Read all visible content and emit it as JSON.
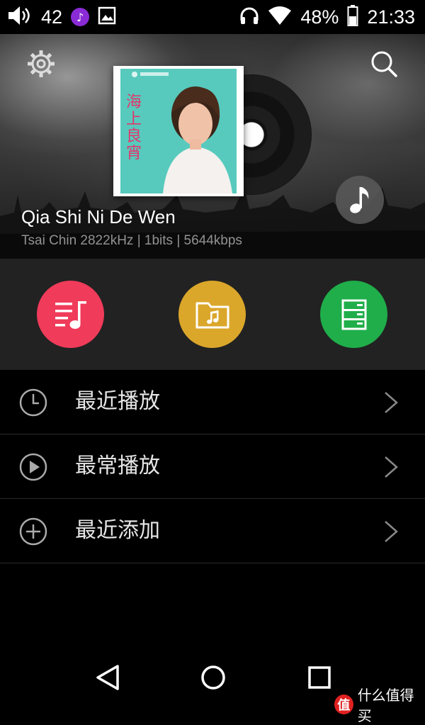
{
  "status_bar": {
    "volume_level": "42",
    "battery": "48%",
    "time": "21:33",
    "icons": [
      "volume-icon",
      "music-app-icon",
      "gallery-icon",
      "headphones-icon",
      "wifi-icon",
      "battery-icon"
    ]
  },
  "now_playing": {
    "title": "Qia Shi Ni De Wen",
    "meta": "Tsai Chin  2822kHz | 1bits | 5644kbps",
    "album_art_text": "海上良宵"
  },
  "actions": [
    {
      "icon": "playlist-icon",
      "color": "#f03b5a"
    },
    {
      "icon": "music-folder-icon",
      "color": "#dba72b"
    },
    {
      "icon": "storage-icon",
      "color": "#1fae4a"
    }
  ],
  "list": [
    {
      "label": "最近播放",
      "icon": "clock-icon"
    },
    {
      "label": "最常播放",
      "icon": "play-circle-icon"
    },
    {
      "label": "最近添加",
      "icon": "plus-circle-icon"
    }
  ],
  "watermark": {
    "logo": "值",
    "text": "什么值得买"
  },
  "colors": {
    "background": "#000000",
    "action_row": "#222222",
    "list_text": "#e6e6e6"
  }
}
